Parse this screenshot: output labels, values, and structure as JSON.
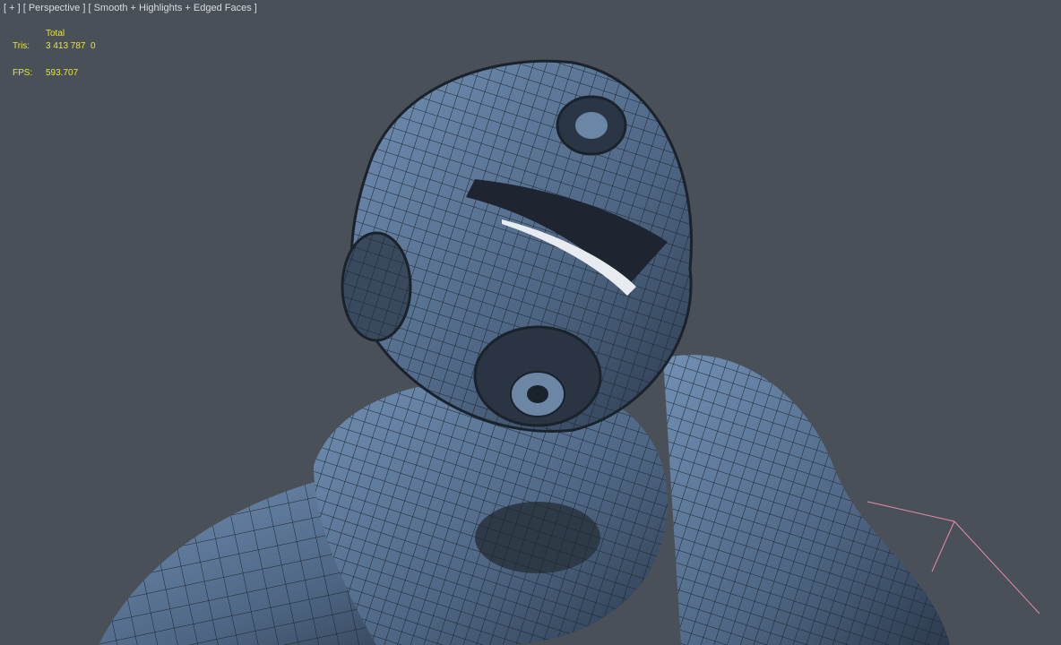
{
  "viewport": {
    "label_menu": "[ + ]",
    "label_view": "[ Perspective ]",
    "label_shading": "[ Smooth + Highlights + Edged Faces ]"
  },
  "stats": {
    "column_header": "Total",
    "tris_label": "Tris:",
    "tris_value": "3 413 787  0",
    "fps_label": "FPS:",
    "fps_value": "593.707"
  },
  "colors": {
    "background": "#4a5058",
    "model": "#5c7698",
    "wire": "#1c242e",
    "stats_text": "#e6e63c",
    "gizmo": "#e88aa8"
  }
}
